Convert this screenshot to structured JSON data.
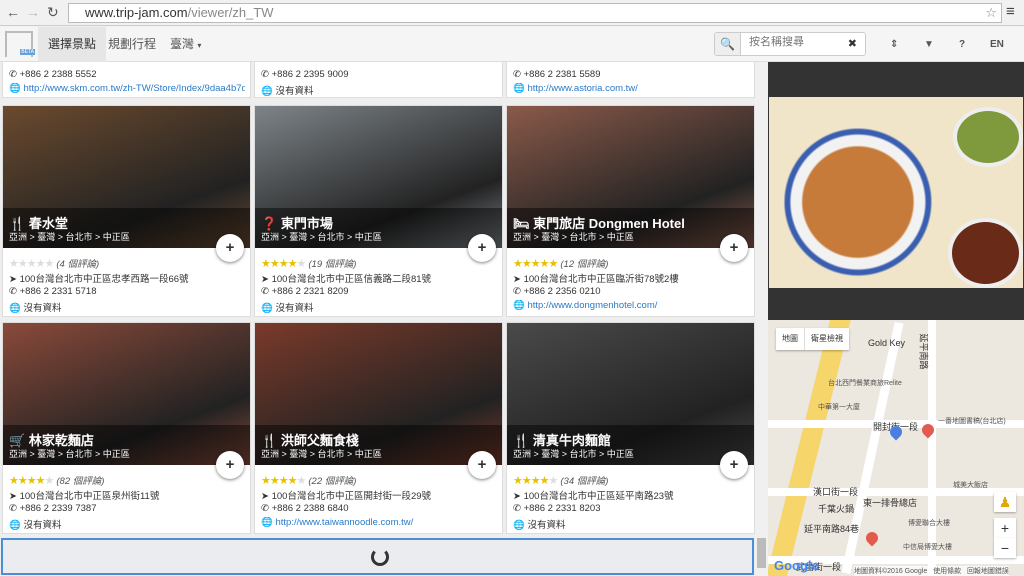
{
  "browser": {
    "url_host": "www.trip-jam.com",
    "url_path": "/viewer/zh_TW"
  },
  "appbar": {
    "logo_badge": "BETA",
    "nav": [
      "選擇景點",
      "規劃行程",
      "臺灣"
    ],
    "search_placeholder": "按名稱搜尋",
    "language": "EN"
  },
  "top_partial": [
    {
      "phone": "+886 2 2388 5552",
      "web": "http://www.skm.com.tw/zh-TW/Store/Index/9daa4b7d-1…",
      "web_is_link": true
    },
    {
      "phone": "+886 2 2395 9009",
      "web": "沒有資料",
      "web_is_link": false
    },
    {
      "phone": "+886 2 2381 5589",
      "web": "http://www.astoria.com.tw/",
      "web_is_link": true
    }
  ],
  "cards": [
    {
      "icon": "restaurant",
      "title": "春水堂",
      "breadcrumb": "亞洲 > 臺灣 > 台北市 > 中正區",
      "rating": 0,
      "reviews": "(4 個評論)",
      "address": "100台灣台北市中正區忠孝西路一段66號",
      "phone": "+886 2 2331 5718",
      "web": "沒有資料",
      "web_is_link": false,
      "color": "#6b4a2e"
    },
    {
      "icon": "question",
      "title": "東門市場",
      "breadcrumb": "亞洲 > 臺灣 > 台北市 > 中正區",
      "rating": 4,
      "reviews": "(19 個評論)",
      "address": "100台灣台北市中正區信義路二段81號",
      "phone": "+886 2 2321 8209",
      "web": "沒有資料",
      "web_is_link": false,
      "color": "#7d8489"
    },
    {
      "icon": "hotel",
      "title": "東門旅店 Dongmen Hotel",
      "breadcrumb": "亞洲 > 臺灣 > 台北市 > 中正區",
      "rating": 4.5,
      "reviews": "(12 個評論)",
      "address": "100台灣台北市中正區臨沂街78號2樓",
      "phone": "+886 2 2356 0210",
      "web": "http://www.dongmenhotel.com/",
      "web_is_link": true,
      "color": "#8a5a4a"
    },
    {
      "icon": "shopping-cart",
      "title": "林家乾麵店",
      "breadcrumb": "亞洲 > 臺灣 > 台北市 > 中正區",
      "rating": 4,
      "reviews": "(82 個評論)",
      "address": "100台灣台北市中正區泉州街11號",
      "phone": "+886 2 2339 7387",
      "web": "沒有資料",
      "web_is_link": false,
      "color": "#8a4a3a"
    },
    {
      "icon": "restaurant",
      "title": "洪師父麵食棧",
      "breadcrumb": "亞洲 > 臺灣 > 台北市 > 中正區",
      "rating": 3.5,
      "reviews": "(22 個評論)",
      "address": "100台灣台北市中正區開封街一段29號",
      "phone": "+886 2 2388 6840",
      "web": "http://www.taiwannoodle.com.tw/",
      "web_is_link": true,
      "color": "#7a3a2a"
    },
    {
      "icon": "restaurant",
      "title": "清真牛肉麵館",
      "breadcrumb": "亞洲 > 臺灣 > 台北市 > 中正區",
      "rating": 3.5,
      "reviews": "(34 個評論)",
      "address": "100台灣台北市中正區延平南路23號",
      "phone": "+886 2 2331 8203",
      "web": "沒有資料",
      "web_is_link": false,
      "color": "#4a4a4a"
    }
  ],
  "map": {
    "types": [
      "地圖",
      "衛星檢視"
    ],
    "labels": [
      "Gold Key",
      "台北西門餐業商旅Relite",
      "中華第一大廈",
      "開封街一段",
      "一番地圖書稿(台北店)",
      "漢口街一段",
      "城美大飯店",
      "東一排骨總店",
      "千葉火鍋",
      "博愛聯合大樓",
      "延平南路84巷",
      "中信局博愛大樓",
      "武昌街一段",
      "延平南路"
    ],
    "attribution": "地圖資料©2016 Google",
    "terms": "使用條款",
    "report": "回報地圖錯誤",
    "brand": "Google"
  }
}
